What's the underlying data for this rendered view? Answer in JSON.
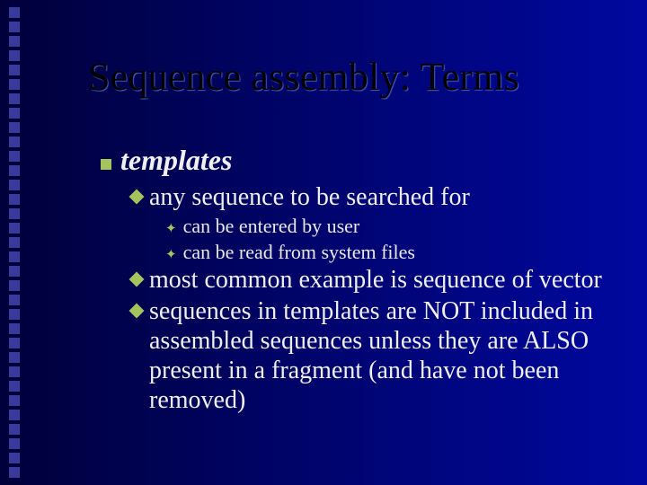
{
  "title": "Sequence assembly: Terms",
  "bullets": {
    "l1": "templates",
    "l2a": "any sequence to be searched for",
    "l3a": "can be entered by user",
    "l3b": "can be read from system files",
    "l2b": "most common example is sequence of vector",
    "l2c": "sequences in templates are NOT included in assembled sequences unless they are ALSO present in a fragment (and have not been removed)"
  }
}
